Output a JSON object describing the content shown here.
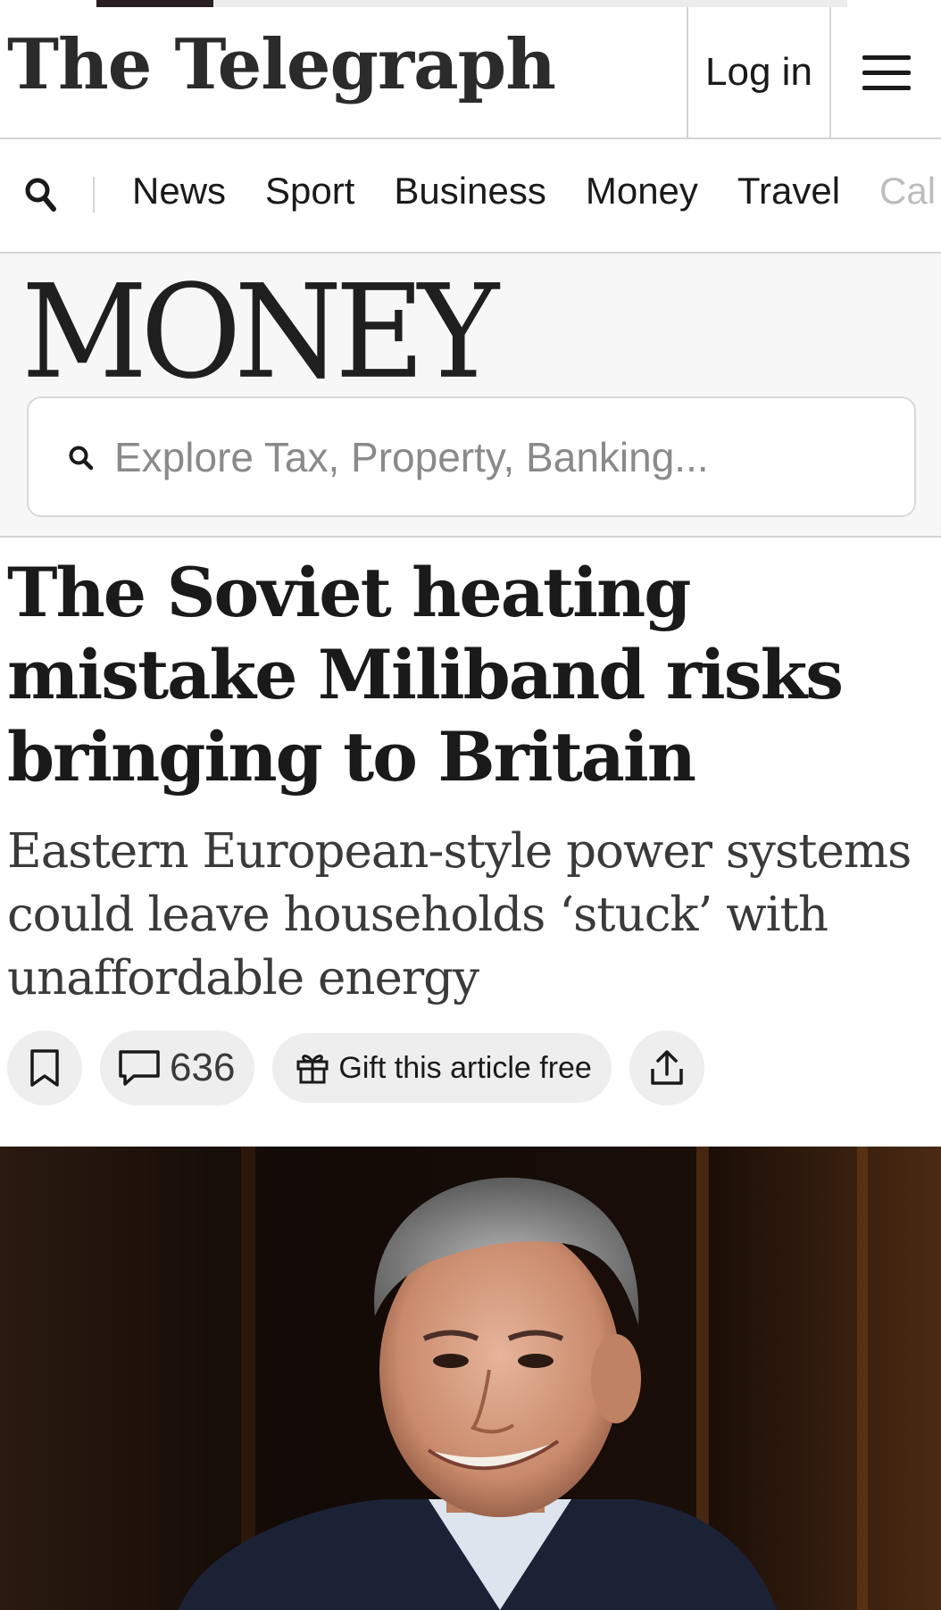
{
  "masthead": {
    "logo": "The Telegraph",
    "login_label": "Log in",
    "menu_icon": "hamburger-menu-icon"
  },
  "nav": {
    "search_icon": "search-icon",
    "items": [
      "News",
      "Sport",
      "Business",
      "Money",
      "Travel",
      "Cal"
    ]
  },
  "section": {
    "title": "MONEY",
    "search": {
      "placeholder": "Explore Tax, Property, Banking...",
      "value": ""
    }
  },
  "article": {
    "headline": "The Soviet heating mistake Miliband risks bringing to Britain",
    "standfirst": "Eastern European-style power systems could leave households ‘stuck’ with unaffordable energy",
    "actions": {
      "bookmark_icon": "bookmark-icon",
      "comment_icon": "comment-icon",
      "comment_count": "636",
      "gift_icon": "gift-icon",
      "gift_label": "Gift this article free",
      "share_icon": "share-icon"
    },
    "hero_image": {
      "subject": "photo-of-man-in-suit-smiling"
    }
  },
  "colors": {
    "text": "#1a1a1a",
    "section_bg": "#f7f7f7",
    "pill_bg": "#eeeeee",
    "border": "#d4d4d4"
  }
}
